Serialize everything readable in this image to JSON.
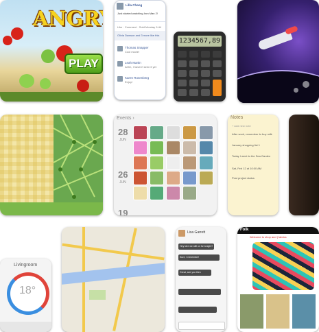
{
  "angry_birds": {
    "title": "ANGRY BI",
    "play_label": "PLAY"
  },
  "facebook": {
    "user": "Lilla Chang",
    "status": "Just started watching Iron Man 2!",
    "actions": "Like · Comment · Sold Monday 9:44",
    "likes": "Olivia Dawson and 3 more like this",
    "c1_name": "Thomas Snapper",
    "c1_text": "Cool movie!",
    "c2_name": "Leah Martin",
    "c2_text": "Ahhh, I haven't seen it yet",
    "c3_name": "Karen Rosenberg",
    "c3_text": "Enjoy!"
  },
  "calculator": {
    "display": "1234567,89"
  },
  "events": {
    "label": "Events ›",
    "day1": "28",
    "mon1": "JUN",
    "day2": "26",
    "mon2": "JUN",
    "day3": "19"
  },
  "notes": {
    "label": "Notes",
    "add": "+ Add new note",
    "n1": "After work, remember to buy milk",
    "n2": "January shopping list 1",
    "n3": "Today I went to the Sea Garden",
    "n4": "Sat, Feb 12 at 10:00 AM",
    "n5": "Post project status"
  },
  "thermostat": {
    "title": "Livingroom",
    "temp": "18°"
  },
  "messages": {
    "contact": "Lisa Garrett",
    "m1": "Hey! Are we still on for tonight?",
    "m2": "Sure, I remember!",
    "m3": "Great, see you then"
  },
  "shop": {
    "logo": "Folk",
    "banner": "Welcome to shop and | fabrics"
  },
  "colors": {
    "accent_blue": "#3b5998",
    "thermo_red": "#e0443a",
    "thermo_blue": "#3a8ee0",
    "calc_orange": "#f08a1c"
  }
}
